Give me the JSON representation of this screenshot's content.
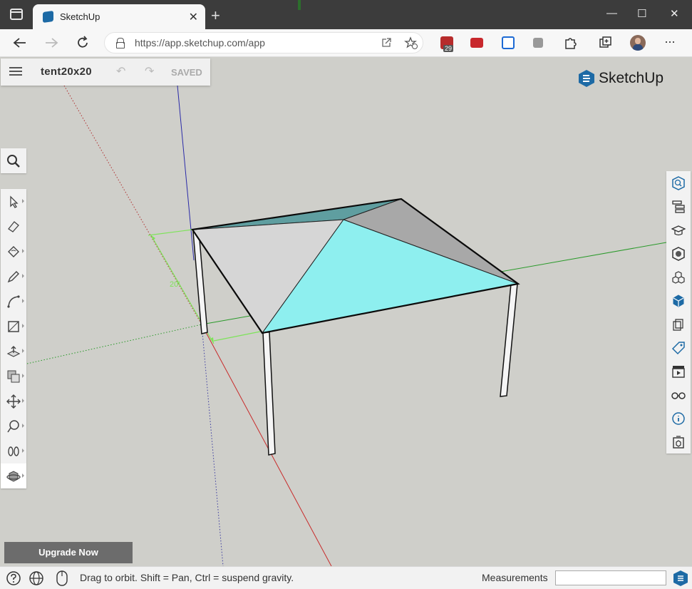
{
  "browser": {
    "tab_title": "SketchUp",
    "tab_close": "✕",
    "new_tab": "+",
    "url": "https://app.sketchup.com/app",
    "extension_badge": "29",
    "window_min": "—",
    "window_max": "☐",
    "window_close": "✕"
  },
  "app": {
    "file_name": "tent20x20",
    "save_status": "SAVED",
    "logo_text": "SketchUp",
    "upgrade_label": "Upgrade Now",
    "dimension_label": "20'"
  },
  "status": {
    "hint": "Drag to orbit. Shift = Pan, Ctrl = suspend gravity.",
    "measurements_label": "Measurements",
    "measurements_value": ""
  },
  "colors": {
    "accent": "#1d6aa5",
    "roof_cyan": "#8eefef",
    "roof_light": "#d6d6d6",
    "roof_grey": "#a9a9a9",
    "roof_teal": "#5e9ea0"
  },
  "left_tools": [
    "search-icon",
    "select-icon",
    "eraser-icon",
    "paint-bucket-icon",
    "pencil-icon",
    "arc-icon",
    "rectangle-icon",
    "push-pull-icon",
    "offset-icon",
    "move-icon",
    "tape-measure-icon",
    "footprints-icon",
    "orbit-icon"
  ],
  "right_panels": [
    "entity-info-icon",
    "outliner-icon",
    "instructor-icon",
    "materials-icon",
    "components-icon",
    "display-icon",
    "solid-icon",
    "tags-icon",
    "scenes-icon",
    "styles-icon",
    "info-icon",
    "3d-warehouse-icon"
  ]
}
